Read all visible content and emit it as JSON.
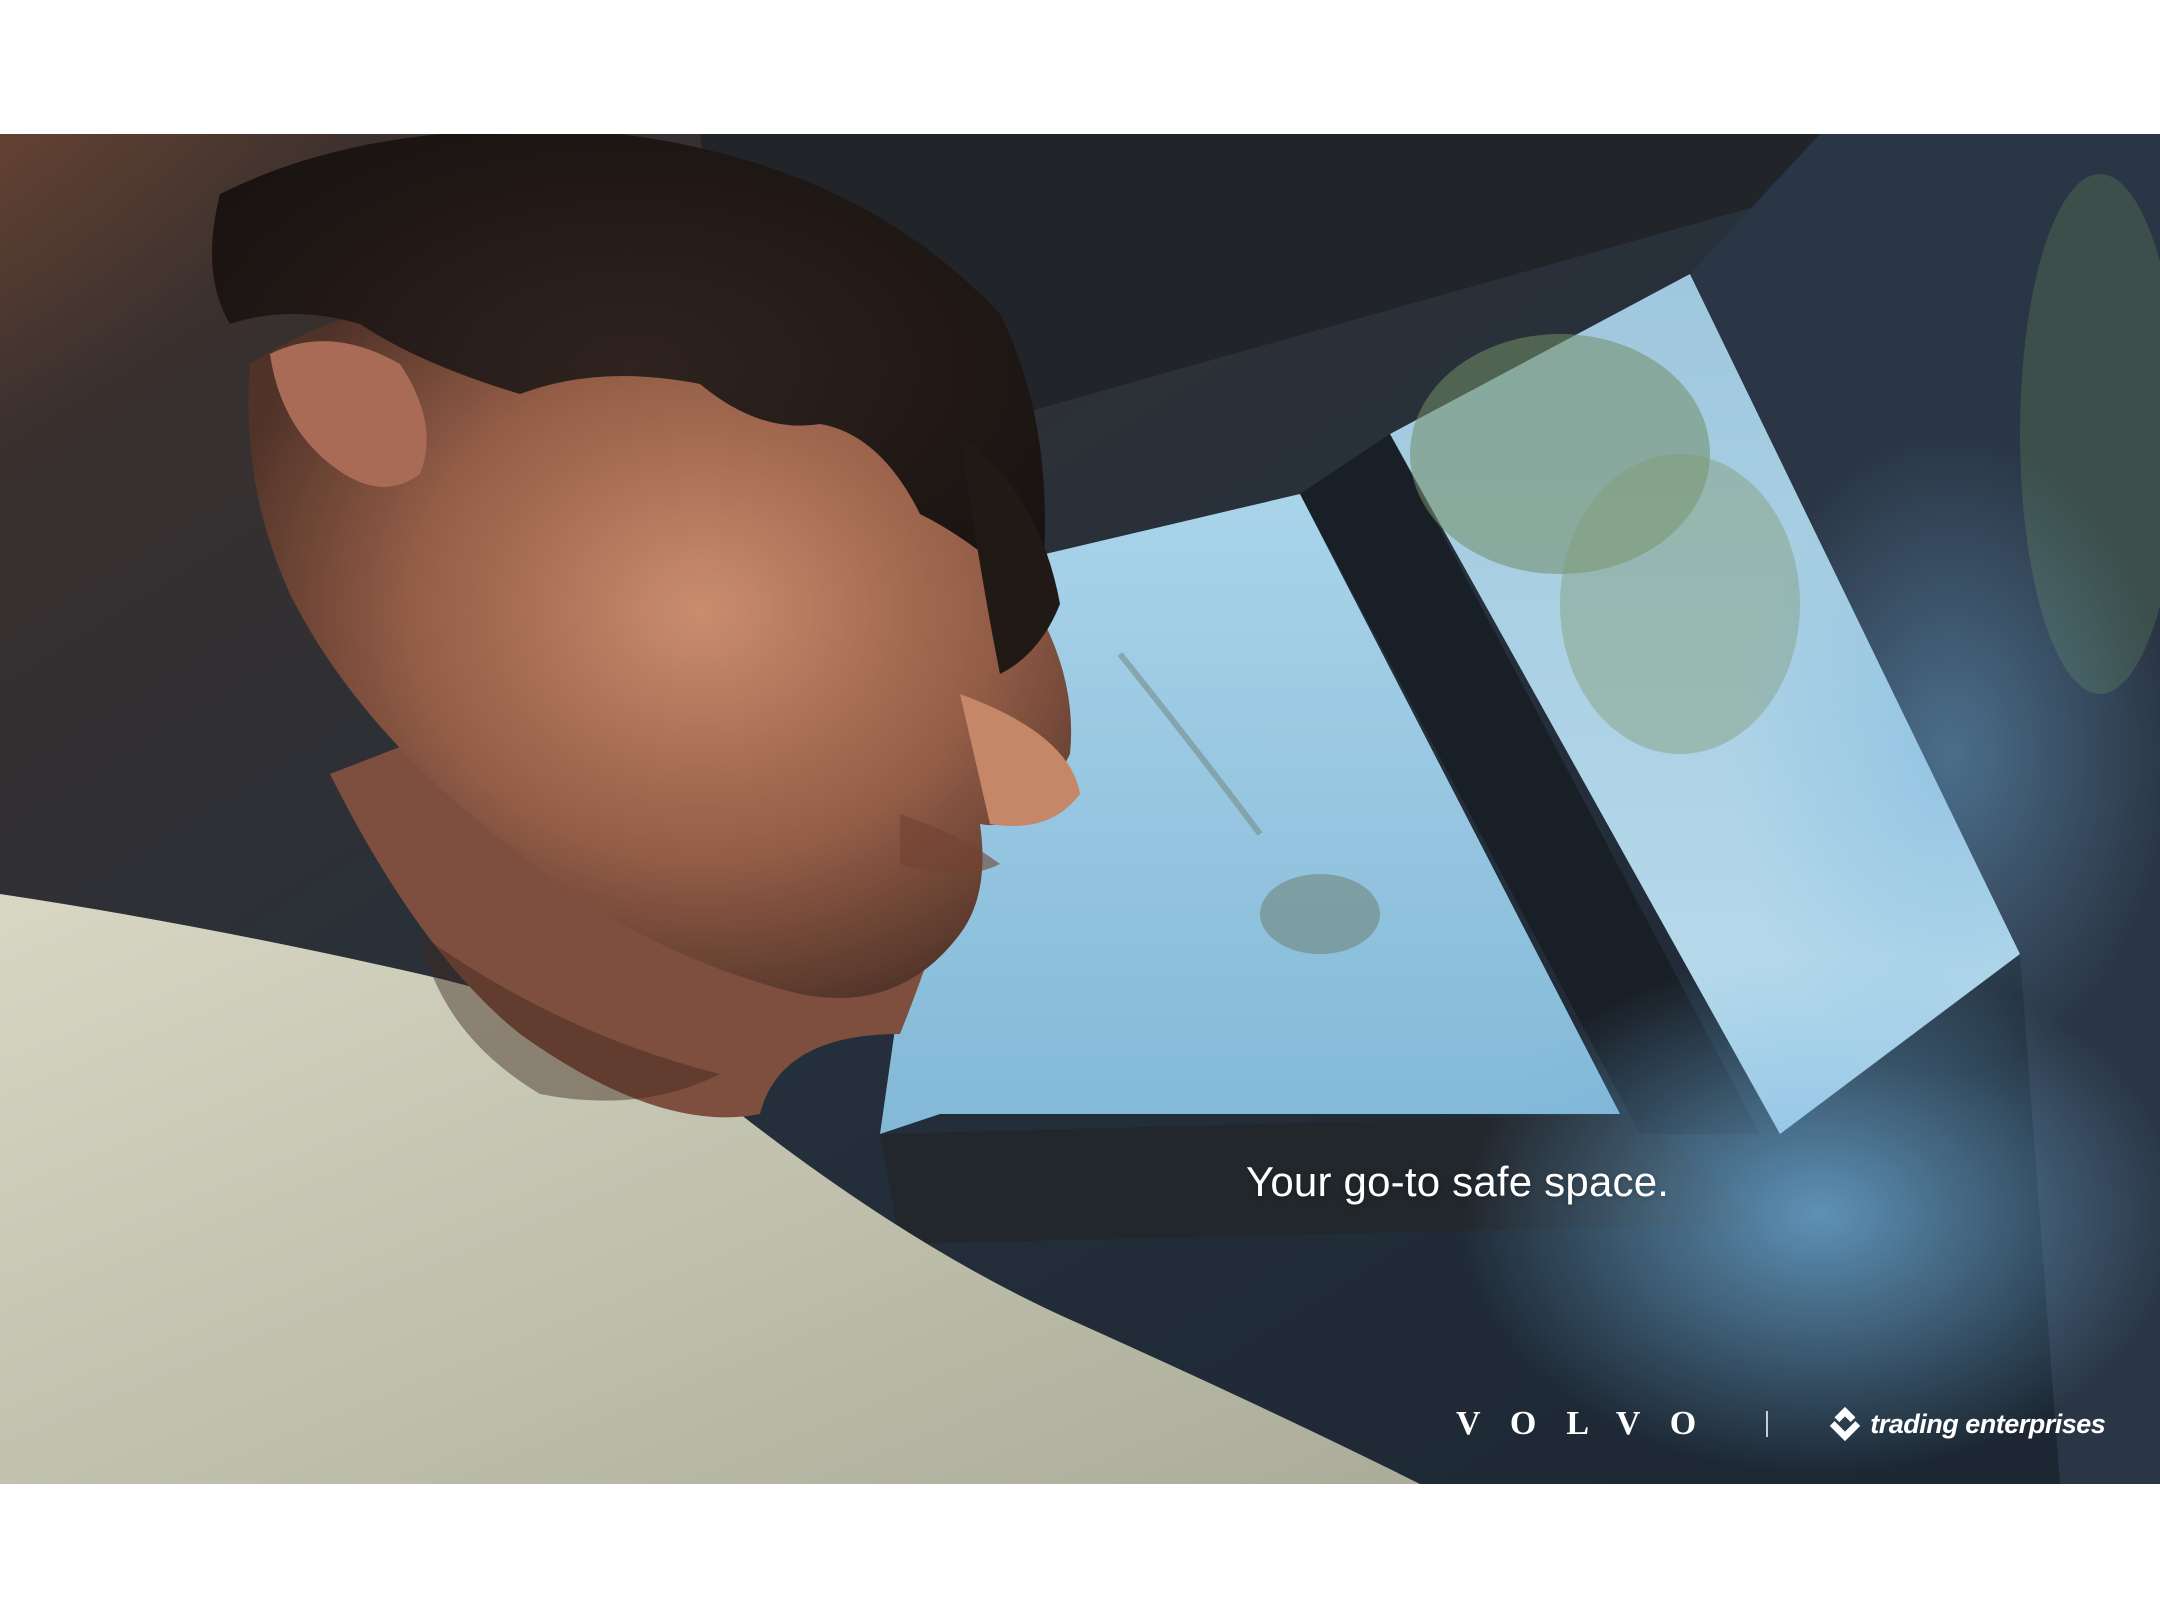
{
  "ad": {
    "tagline": "Your go-to safe space.",
    "brand_primary": "VOLVO",
    "brand_partner": "trading enterprises"
  },
  "photo": {
    "subject": "man-looking-out-car-window-icon",
    "sky_color": "#8cc0dd",
    "skin_color": "#b7775b",
    "shirt_color": "#c8c8b4"
  }
}
